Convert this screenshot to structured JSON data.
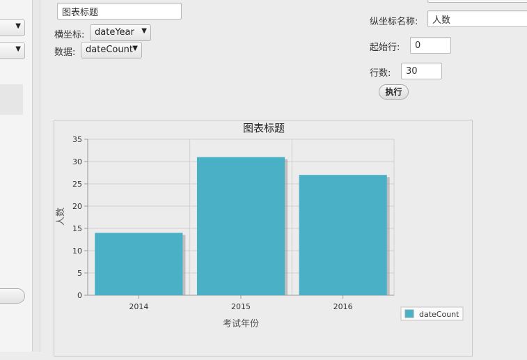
{
  "form": {
    "title_value": "图表标题",
    "x_axis_label": "横坐标:",
    "x_axis_value": "dateYear",
    "data_label": "数据:",
    "data_value": "dateCount",
    "y_axis_name_label": "纵坐标名称:",
    "y_axis_name_value": "人数",
    "start_row_label": "起始行:",
    "start_row_value": "0",
    "row_count_label": "行数:",
    "row_count_value": "30",
    "execute_label": "执行"
  },
  "chart_data": {
    "type": "bar",
    "title": "图表标题",
    "xlabel": "考试年份",
    "ylabel": "人数",
    "categories": [
      "2014",
      "2015",
      "2016"
    ],
    "series": [
      {
        "name": "dateCount",
        "values": [
          14,
          31,
          27
        ]
      }
    ],
    "ylim": [
      0,
      35
    ],
    "yticks": [
      0,
      5,
      10,
      15,
      20,
      25,
      30,
      35
    ],
    "grid": true,
    "legend": "bottom-right",
    "bar_color": "#4ab0c6"
  }
}
